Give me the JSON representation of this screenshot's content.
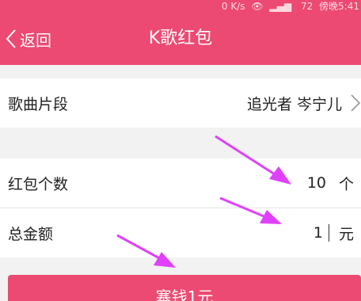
{
  "status_bar": {
    "network_speed": "0 K/s",
    "battery": "72",
    "time": "傍晚5:41"
  },
  "nav": {
    "back_label": "返回",
    "title": "K歌红包"
  },
  "song_row": {
    "label": "歌曲片段",
    "value": "追光者 岑宁儿"
  },
  "count_row": {
    "label": "红包个数",
    "value": "10",
    "unit": "个"
  },
  "amount_row": {
    "label": "总金额",
    "value": "1",
    "unit": "元"
  },
  "submit": {
    "label": "塞钱1元"
  },
  "colors": {
    "accent": "#ec4a72",
    "annotation_arrow": "#e040fb"
  }
}
